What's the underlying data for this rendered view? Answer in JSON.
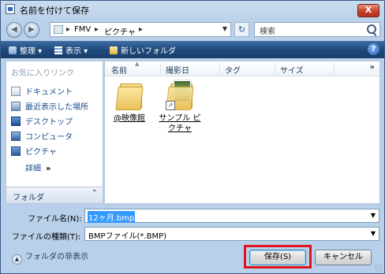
{
  "window": {
    "title": "名前を付けて保存",
    "close_glyph": "X"
  },
  "address": {
    "crumbs": [
      "FMV",
      "ピクチャ"
    ],
    "separator": "▸",
    "search_placeholder": "検索"
  },
  "toolbar": {
    "organize": "整理",
    "view": "表示",
    "new_folder": "新しいフォルダ",
    "help": "?"
  },
  "nav": {
    "favorites_header": "お気に入りリンク",
    "items": [
      {
        "label": "ドキュメント",
        "icon": "documents-icon"
      },
      {
        "label": "最近表示した場所",
        "icon": "recent-places-icon"
      },
      {
        "label": "デスクトップ",
        "icon": "desktop-icon"
      },
      {
        "label": "コンピュータ",
        "icon": "computer-icon"
      },
      {
        "label": "ピクチャ",
        "icon": "pictures-icon"
      }
    ],
    "more_label": "詳細",
    "more_arrow": "»",
    "folders_label": "フォルダ"
  },
  "columns": {
    "name": "名前",
    "date_taken": "撮影日",
    "tags": "タグ",
    "size": "サイズ",
    "more": "»"
  },
  "files": [
    {
      "name": "@映像館"
    },
    {
      "name_line1": "サンプル ピ",
      "name_line2": "クチャ"
    }
  ],
  "filename": {
    "label": "ファイル名(N):",
    "value": "12ヶ月.bmp"
  },
  "filetype": {
    "label": "ファイルの種類(T):",
    "value": "BMPファイル(*.BMP)"
  },
  "footer": {
    "hide_folders": "フォルダの非表示"
  },
  "buttons": {
    "save": "保存(S)",
    "cancel": "キャンセル"
  },
  "colors": {
    "highlight": "#e0141c",
    "toolbar": "#1f4a7c"
  }
}
